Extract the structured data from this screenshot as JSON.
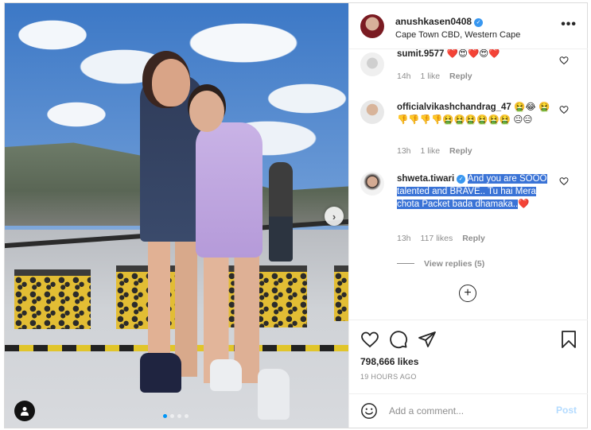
{
  "post": {
    "author": "anushkasen0408",
    "location": "Cape Town CBD, Western Cape",
    "more_label": "•••"
  },
  "colors": {
    "accent": "#0095f6",
    "verified": "#3897f0",
    "highlight": "#3a73d6",
    "heart": "#ed4956"
  },
  "icons": {
    "verified": "verified-badge-icon",
    "next": "chevron-right-icon",
    "tag": "user-tag-icon",
    "like": "heart-icon",
    "comment": "comment-icon",
    "share": "paper-plane-icon",
    "save": "bookmark-icon",
    "emoji": "smiley-icon",
    "load_more": "plus-circle-icon"
  },
  "carousel": {
    "slide_count": 4,
    "active_index": 0
  },
  "comments": [
    {
      "user": "sumit.9577",
      "text": "❤️😍❤️😍❤️",
      "age": "14h",
      "likes": "1 like",
      "reply": "Reply",
      "highlighted": false
    },
    {
      "user": "officialvikashchandrag_47",
      "text": "🤮😂 🤮👎👎👎👎🤮🤮🤮🤮🤮🤮 😐😑",
      "age": "13h",
      "likes": "1 like",
      "reply": "Reply",
      "highlighted": false
    },
    {
      "user": "shweta.tiwari",
      "verified": true,
      "text": "And you are SOOO talented and BRAVE.. Tu hai Mera chota Packet bada dhamaka..",
      "heart": "❤️",
      "age": "13h",
      "likes": "117 likes",
      "reply": "Reply",
      "highlighted": true
    }
  ],
  "view_replies": "View replies (5)",
  "likes": "798,666 likes",
  "timestamp": "19 HOURS AGO",
  "comment_box": {
    "placeholder": "Add a comment...",
    "post_label": "Post"
  }
}
